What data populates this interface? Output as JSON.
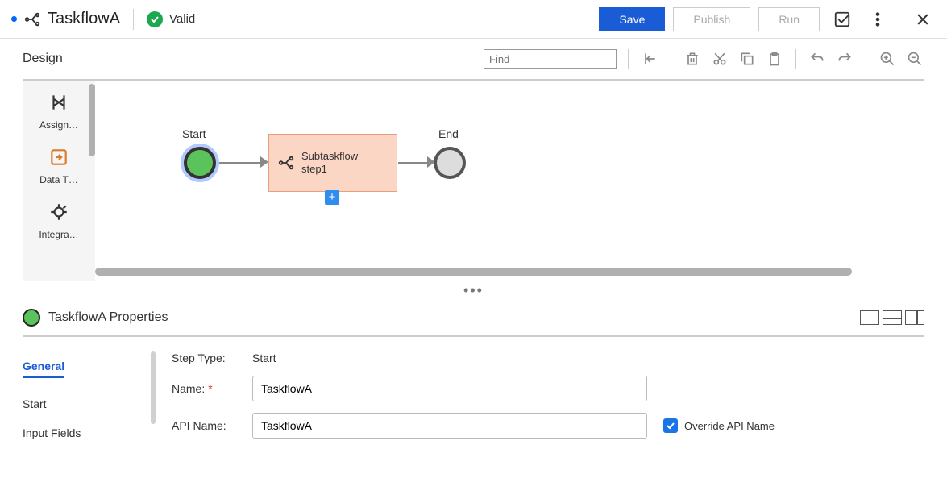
{
  "header": {
    "title": "TaskflowA",
    "status": "Valid",
    "buttons": {
      "save": "Save",
      "publish": "Publish",
      "run": "Run"
    }
  },
  "design": {
    "label": "Design",
    "find_placeholder": "Find"
  },
  "palette": {
    "items": [
      {
        "label": "Assign…"
      },
      {
        "label": "Data T…"
      },
      {
        "label": "Integra…"
      }
    ]
  },
  "canvas": {
    "start_label": "Start",
    "end_label": "End",
    "sub_step": {
      "line1": "Subtaskflow",
      "line2": "step1"
    }
  },
  "properties": {
    "title": "TaskflowA Properties",
    "tabs": {
      "general": "General",
      "start": "Start",
      "input_fields": "Input Fields"
    },
    "form": {
      "step_type_label": "Step Type:",
      "step_type_value": "Start",
      "name_label": "Name:",
      "name_value": "TaskflowA",
      "api_name_label": "API Name:",
      "api_name_value": "TaskflowA",
      "override_label": "Override API Name"
    }
  }
}
